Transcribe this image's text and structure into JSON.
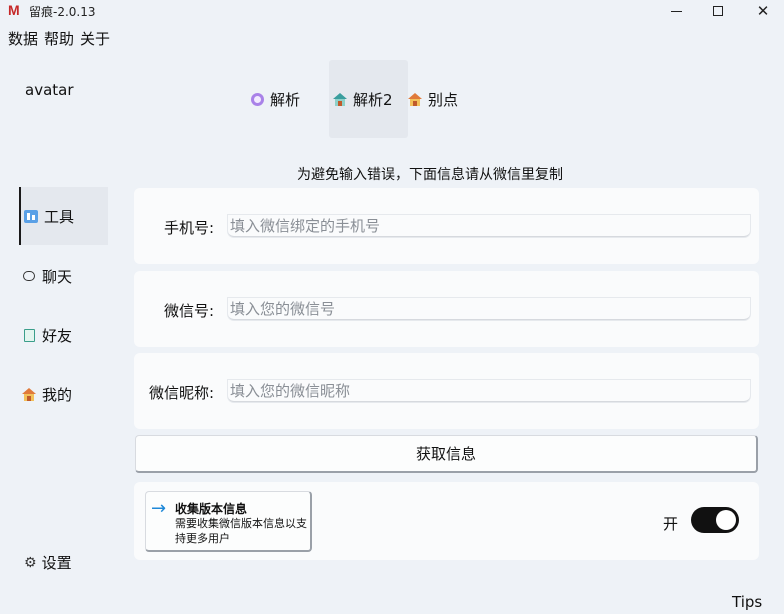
{
  "window": {
    "logo": "M",
    "title": "留痕-2.0.13"
  },
  "menu": [
    "数据",
    "帮助",
    "关于"
  ],
  "avatar": "avatar",
  "tabs": [
    {
      "label": "解析",
      "icon": "purple-ring-icon"
    },
    {
      "label": "解析2",
      "icon": "house-icon",
      "active": true
    },
    {
      "label": "别点",
      "icon": "house-icon"
    }
  ],
  "sidebar": {
    "items": [
      {
        "label": "工具",
        "icon": "tools-icon",
        "active": true
      },
      {
        "label": "聊天",
        "icon": "chat-icon"
      },
      {
        "label": "好友",
        "icon": "book-icon"
      },
      {
        "label": "我的",
        "icon": "house-icon"
      }
    ],
    "settings": "设置"
  },
  "notice": "为避免输入错误，下面信息请从微信里复制",
  "form": {
    "phone": {
      "label": "手机号:",
      "placeholder": "填入微信绑定的手机号"
    },
    "wechat": {
      "label": "微信号:",
      "placeholder": "填入您的微信号"
    },
    "nickname": {
      "label": "微信昵称:",
      "placeholder": "填入您的微信昵称"
    },
    "submit": "获取信息"
  },
  "collect": {
    "title": "收集版本信息",
    "description": "需要收集微信版本信息以支持更多用户",
    "toggle_label": "开",
    "toggle_on": true
  },
  "tips": "Tips",
  "colors": {
    "background": "#eef2f7",
    "card": "#fafbfc",
    "accent_arrow": "#1e88d8",
    "toggle_on": "#111111"
  }
}
